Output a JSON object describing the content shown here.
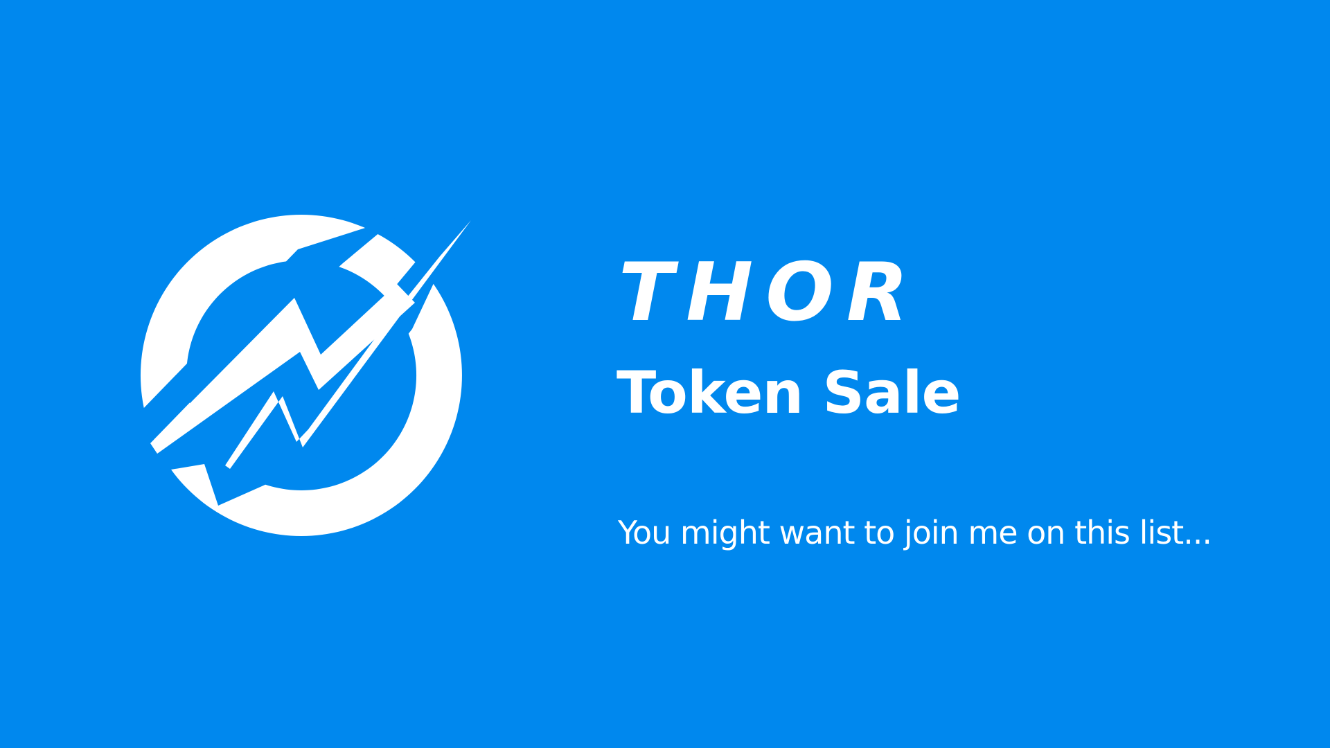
{
  "colors": {
    "background": "#0088ee",
    "foreground": "#ffffff"
  },
  "logo": {
    "icon": "thor-lightning-circle-logo"
  },
  "brand": {
    "name": "THOR"
  },
  "headline": "Token Sale",
  "tagline": "You might want to join me on this list..."
}
